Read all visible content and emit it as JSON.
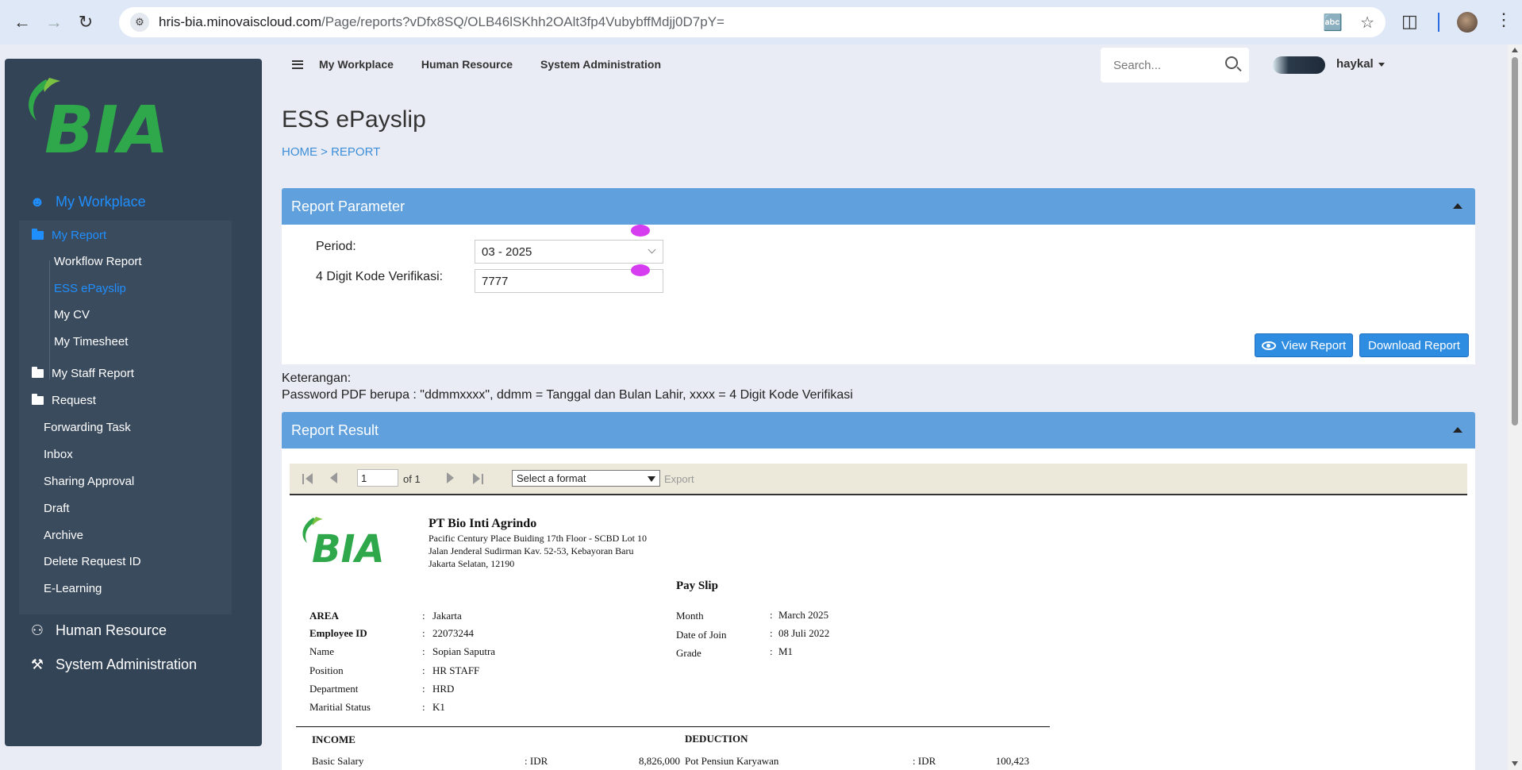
{
  "browser": {
    "url_host": "hris-bia.minovaiscloud.com",
    "url_path": "/Page/reports?vDfx8SQ/OLB46lSKhh2OAlt3fp4VubybffMdjj0D7pY="
  },
  "sidebar": {
    "logo_text": "BIA",
    "main_items": [
      {
        "label": "My Workplace"
      },
      {
        "label": "Human Resource"
      },
      {
        "label": "System Administration"
      }
    ],
    "my_report": "My Report",
    "report_items": [
      {
        "label": "Workflow Report"
      },
      {
        "label": "ESS ePayslip"
      },
      {
        "label": "My CV"
      },
      {
        "label": "My Timesheet"
      }
    ],
    "my_staff_report": "My Staff Report",
    "request": "Request",
    "request_items": [
      {
        "label": "Forwarding Task"
      },
      {
        "label": "Inbox"
      },
      {
        "label": "Sharing Approval"
      },
      {
        "label": "Draft"
      },
      {
        "label": "Archive"
      },
      {
        "label": "Delete Request ID"
      },
      {
        "label": "E-Learning"
      }
    ]
  },
  "topnav": {
    "links": [
      "My Workplace",
      "Human Resource",
      "System Administration"
    ],
    "search_placeholder": "Search...",
    "username": "haykal"
  },
  "page": {
    "title": "ESS ePayslip",
    "breadcrumb": "HOME  >  REPORT"
  },
  "parameter": {
    "header": "Report Parameter",
    "period_label": "Period:",
    "period_value": "03 - 2025",
    "code_label": "4 Digit Kode Verifikasi:",
    "code_value": "7777",
    "view_button": "View Report",
    "download_button": "Download Report"
  },
  "notes": {
    "title": "Keterangan:",
    "text": "Password PDF berupa : \"ddmmxxxx\", ddmm = Tanggal dan Bulan Lahir, xxxx = 4 Digit Kode Verifikasi"
  },
  "result": {
    "header": "Report Result",
    "page_value": "1",
    "of_label": "of 1",
    "format_placeholder": "Select a format",
    "export_label": "Export"
  },
  "payslip": {
    "logo_text": "BIA",
    "company": "PT  Bio Inti Agrindo",
    "address": [
      "Pacific Century Place Buiding 17th Floor - SCBD Lot 10",
      "Jalan Jenderal Sudirman Kav. 52-53, Kebayoran Baru",
      "Jakarta Selatan, 12190"
    ],
    "title": "Pay Slip",
    "left_fields": [
      {
        "label": "AREA",
        "value": "Jakarta"
      },
      {
        "label": "Employee ID",
        "value": "22073244"
      },
      {
        "label": "Name",
        "value": "Sopian Saputra"
      },
      {
        "label": "Position",
        "value": "HR STAFF"
      },
      {
        "label": "Department",
        "value": "HRD"
      },
      {
        "label": "Maritial Status",
        "value": "K1"
      }
    ],
    "right_fields": [
      {
        "label": "Month",
        "value": "March 2025"
      },
      {
        "label": "Date of Join",
        "value": "08 Juli 2022"
      },
      {
        "label": "Grade",
        "value": "M1"
      }
    ],
    "income_header": "INCOME",
    "deduction_header": "DEDUCTION",
    "income_rows": [
      {
        "label": "Basic Salary",
        "currency": ": IDR",
        "amount": "8,826,000"
      }
    ],
    "deduction_rows": [
      {
        "label": "Pot Pensiun Karyawan",
        "currency": ": IDR",
        "amount": "100,423"
      }
    ]
  }
}
